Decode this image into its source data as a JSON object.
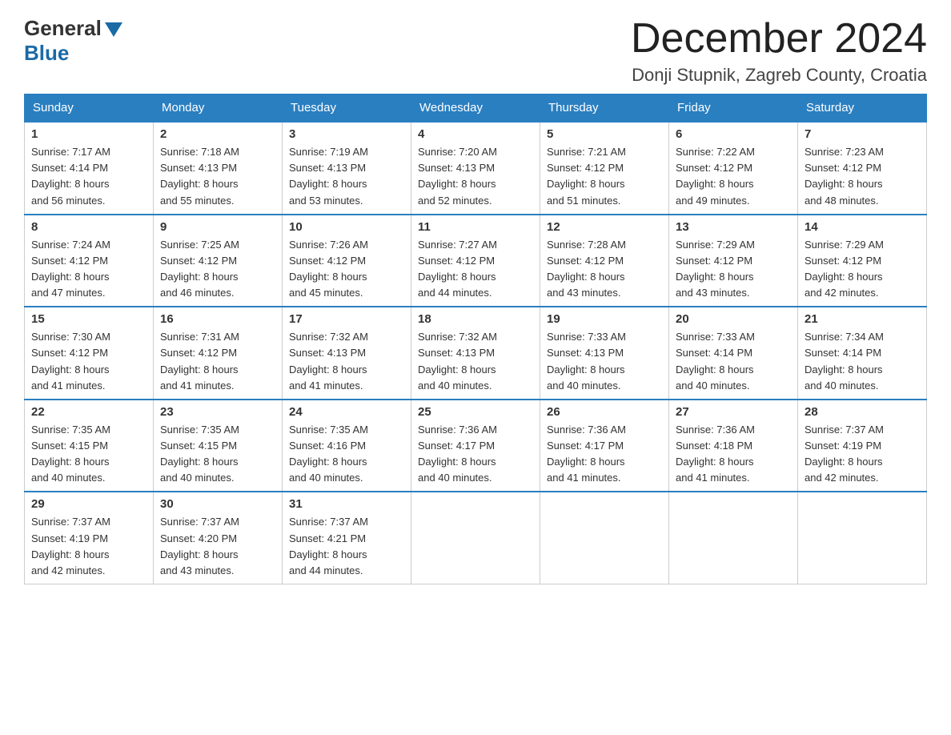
{
  "logo": {
    "general": "General",
    "blue": "Blue"
  },
  "title": {
    "month_year": "December 2024",
    "location": "Donji Stupnik, Zagreb County, Croatia"
  },
  "weekdays": [
    "Sunday",
    "Monday",
    "Tuesday",
    "Wednesday",
    "Thursday",
    "Friday",
    "Saturday"
  ],
  "weeks": [
    [
      {
        "day": "1",
        "sunrise": "7:17 AM",
        "sunset": "4:14 PM",
        "daylight": "8 hours and 56 minutes."
      },
      {
        "day": "2",
        "sunrise": "7:18 AM",
        "sunset": "4:13 PM",
        "daylight": "8 hours and 55 minutes."
      },
      {
        "day": "3",
        "sunrise": "7:19 AM",
        "sunset": "4:13 PM",
        "daylight": "8 hours and 53 minutes."
      },
      {
        "day": "4",
        "sunrise": "7:20 AM",
        "sunset": "4:13 PM",
        "daylight": "8 hours and 52 minutes."
      },
      {
        "day": "5",
        "sunrise": "7:21 AM",
        "sunset": "4:12 PM",
        "daylight": "8 hours and 51 minutes."
      },
      {
        "day": "6",
        "sunrise": "7:22 AM",
        "sunset": "4:12 PM",
        "daylight": "8 hours and 49 minutes."
      },
      {
        "day": "7",
        "sunrise": "7:23 AM",
        "sunset": "4:12 PM",
        "daylight": "8 hours and 48 minutes."
      }
    ],
    [
      {
        "day": "8",
        "sunrise": "7:24 AM",
        "sunset": "4:12 PM",
        "daylight": "8 hours and 47 minutes."
      },
      {
        "day": "9",
        "sunrise": "7:25 AM",
        "sunset": "4:12 PM",
        "daylight": "8 hours and 46 minutes."
      },
      {
        "day": "10",
        "sunrise": "7:26 AM",
        "sunset": "4:12 PM",
        "daylight": "8 hours and 45 minutes."
      },
      {
        "day": "11",
        "sunrise": "7:27 AM",
        "sunset": "4:12 PM",
        "daylight": "8 hours and 44 minutes."
      },
      {
        "day": "12",
        "sunrise": "7:28 AM",
        "sunset": "4:12 PM",
        "daylight": "8 hours and 43 minutes."
      },
      {
        "day": "13",
        "sunrise": "7:29 AM",
        "sunset": "4:12 PM",
        "daylight": "8 hours and 43 minutes."
      },
      {
        "day": "14",
        "sunrise": "7:29 AM",
        "sunset": "4:12 PM",
        "daylight": "8 hours and 42 minutes."
      }
    ],
    [
      {
        "day": "15",
        "sunrise": "7:30 AM",
        "sunset": "4:12 PM",
        "daylight": "8 hours and 41 minutes."
      },
      {
        "day": "16",
        "sunrise": "7:31 AM",
        "sunset": "4:12 PM",
        "daylight": "8 hours and 41 minutes."
      },
      {
        "day": "17",
        "sunrise": "7:32 AM",
        "sunset": "4:13 PM",
        "daylight": "8 hours and 41 minutes."
      },
      {
        "day": "18",
        "sunrise": "7:32 AM",
        "sunset": "4:13 PM",
        "daylight": "8 hours and 40 minutes."
      },
      {
        "day": "19",
        "sunrise": "7:33 AM",
        "sunset": "4:13 PM",
        "daylight": "8 hours and 40 minutes."
      },
      {
        "day": "20",
        "sunrise": "7:33 AM",
        "sunset": "4:14 PM",
        "daylight": "8 hours and 40 minutes."
      },
      {
        "day": "21",
        "sunrise": "7:34 AM",
        "sunset": "4:14 PM",
        "daylight": "8 hours and 40 minutes."
      }
    ],
    [
      {
        "day": "22",
        "sunrise": "7:35 AM",
        "sunset": "4:15 PM",
        "daylight": "8 hours and 40 minutes."
      },
      {
        "day": "23",
        "sunrise": "7:35 AM",
        "sunset": "4:15 PM",
        "daylight": "8 hours and 40 minutes."
      },
      {
        "day": "24",
        "sunrise": "7:35 AM",
        "sunset": "4:16 PM",
        "daylight": "8 hours and 40 minutes."
      },
      {
        "day": "25",
        "sunrise": "7:36 AM",
        "sunset": "4:17 PM",
        "daylight": "8 hours and 40 minutes."
      },
      {
        "day": "26",
        "sunrise": "7:36 AM",
        "sunset": "4:17 PM",
        "daylight": "8 hours and 41 minutes."
      },
      {
        "day": "27",
        "sunrise": "7:36 AM",
        "sunset": "4:18 PM",
        "daylight": "8 hours and 41 minutes."
      },
      {
        "day": "28",
        "sunrise": "7:37 AM",
        "sunset": "4:19 PM",
        "daylight": "8 hours and 42 minutes."
      }
    ],
    [
      {
        "day": "29",
        "sunrise": "7:37 AM",
        "sunset": "4:19 PM",
        "daylight": "8 hours and 42 minutes."
      },
      {
        "day": "30",
        "sunrise": "7:37 AM",
        "sunset": "4:20 PM",
        "daylight": "8 hours and 43 minutes."
      },
      {
        "day": "31",
        "sunrise": "7:37 AM",
        "sunset": "4:21 PM",
        "daylight": "8 hours and 44 minutes."
      },
      null,
      null,
      null,
      null
    ]
  ],
  "labels": {
    "sunrise": "Sunrise:",
    "sunset": "Sunset:",
    "daylight": "Daylight:"
  }
}
